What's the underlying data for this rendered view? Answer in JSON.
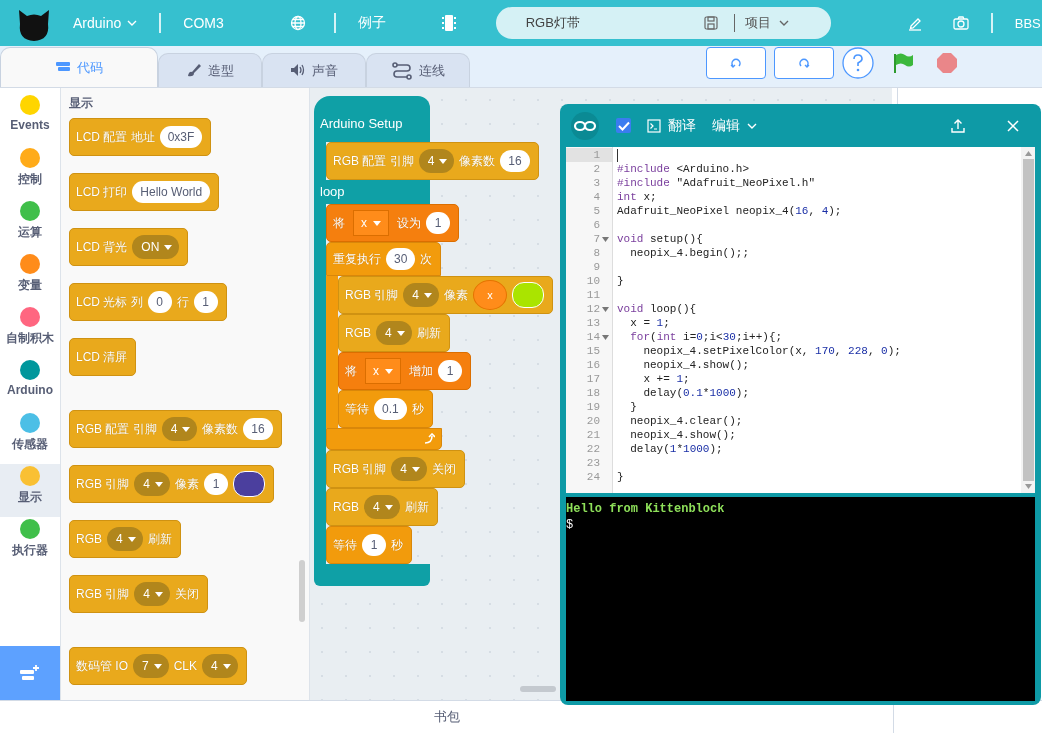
{
  "header": {
    "board": "Arduino",
    "port": "COM3",
    "examples": "例子",
    "project_name": "RGB灯带",
    "project_menu": "项目",
    "bbs": "BBS"
  },
  "tabs": [
    {
      "label": "代码",
      "selected": true
    },
    {
      "label": "造型",
      "selected": false
    },
    {
      "label": "声音",
      "selected": false
    },
    {
      "label": "连线",
      "selected": false
    }
  ],
  "categories": [
    {
      "label": "Events",
      "color": "#ffd500",
      "selected": false
    },
    {
      "label": "控制",
      "color": "#ffab19",
      "selected": false
    },
    {
      "label": "运算",
      "color": "#40bf4a",
      "selected": false
    },
    {
      "label": "变量",
      "color": "#ff8c1a",
      "selected": false
    },
    {
      "label": "自制积木",
      "color": "#ff6680",
      "selected": false
    },
    {
      "label": "Arduino",
      "color": "#00979c",
      "selected": false
    },
    {
      "label": "传感器",
      "color": "#4cbfe6",
      "selected": false
    },
    {
      "label": "显示",
      "color": "#f9c033",
      "selected": true
    },
    {
      "label": "执行器",
      "color": "#40bf4a",
      "selected": false
    }
  ],
  "palette": {
    "title": "显示",
    "groups": [
      [
        {
          "kind": "display",
          "parts": [
            {
              "kind": "label",
              "text": "LCD 配置 地址"
            },
            {
              "kind": "input",
              "text": "0x3F"
            }
          ]
        },
        {
          "kind": "display",
          "parts": [
            {
              "kind": "label",
              "text": "LCD 打印"
            },
            {
              "kind": "input",
              "text": "Hello World"
            }
          ]
        },
        {
          "kind": "display",
          "parts": [
            {
              "kind": "label",
              "text": "LCD 背光"
            },
            {
              "kind": "dropdown",
              "text": "ON"
            }
          ]
        },
        {
          "kind": "display",
          "parts": [
            {
              "kind": "label",
              "text": "LCD 光标 列"
            },
            {
              "kind": "input",
              "text": "0"
            },
            {
              "kind": "label",
              "text": "行"
            },
            {
              "kind": "input",
              "text": "1"
            }
          ]
        },
        {
          "kind": "display",
          "parts": [
            {
              "kind": "label",
              "text": "LCD 清屏"
            }
          ]
        }
      ],
      [
        {
          "kind": "display",
          "parts": [
            {
              "kind": "label",
              "text": "RGB 配置 引脚"
            },
            {
              "kind": "dropdown",
              "text": "4"
            },
            {
              "kind": "label",
              "text": "像素数"
            },
            {
              "kind": "input",
              "text": "16"
            }
          ]
        },
        {
          "kind": "display",
          "parts": [
            {
              "kind": "label",
              "text": "RGB 引脚"
            },
            {
              "kind": "dropdown",
              "text": "4"
            },
            {
              "kind": "label",
              "text": "像素"
            },
            {
              "kind": "input",
              "text": "1"
            },
            {
              "kind": "color",
              "color": "#4b3f9e"
            }
          ]
        },
        {
          "kind": "display",
          "parts": [
            {
              "kind": "label",
              "text": "RGB"
            },
            {
              "kind": "dropdown",
              "text": "4"
            },
            {
              "kind": "label",
              "text": "刷新"
            }
          ]
        },
        {
          "kind": "display",
          "parts": [
            {
              "kind": "label",
              "text": "RGB 引脚"
            },
            {
              "kind": "dropdown",
              "text": "4"
            },
            {
              "kind": "label",
              "text": "关闭"
            }
          ]
        }
      ],
      [
        {
          "kind": "display",
          "parts": [
            {
              "kind": "label",
              "text": "数码管 IO"
            },
            {
              "kind": "dropdown",
              "text": "7"
            },
            {
              "kind": "label",
              "text": "CLK"
            },
            {
              "kind": "dropdown",
              "text": "4"
            }
          ]
        }
      ]
    ]
  },
  "script": {
    "sections": [
      {
        "label": "Arduino Setup",
        "children": [
          {
            "kind": "display",
            "parts": [
              {
                "kind": "label",
                "text": "RGB 配置 引脚"
              },
              {
                "kind": "dropdown",
                "text": "4"
              },
              {
                "kind": "label",
                "text": "像素数"
              },
              {
                "kind": "input",
                "text": "16"
              }
            ]
          }
        ]
      },
      {
        "label": "loop",
        "children": [
          {
            "kind": "variable",
            "parts": [
              {
                "kind": "label",
                "text": "将"
              },
              {
                "kind": "variable",
                "text": "x"
              },
              {
                "kind": "label",
                "text": "设为"
              },
              {
                "kind": "input",
                "text": "1"
              }
            ]
          },
          {
            "kind": "control",
            "parts": [
              {
                "kind": "label",
                "text": "重复执行"
              },
              {
                "kind": "input",
                "text": "30"
              },
              {
                "kind": "label",
                "text": "次"
              }
            ],
            "children": [
              {
                "kind": "display",
                "parts": [
                  {
                    "kind": "label",
                    "text": "RGB 引脚"
                  },
                  {
                    "kind": "dropdown",
                    "text": "4"
                  },
                  {
                    "kind": "label",
                    "text": "像素"
                  },
                  {
                    "kind": "reporter",
                    "text": "x"
                  },
                  {
                    "kind": "color",
                    "color": "#aae400"
                  }
                ]
              },
              {
                "kind": "display",
                "parts": [
                  {
                    "kind": "label",
                    "text": "RGB"
                  },
                  {
                    "kind": "dropdown",
                    "text": "4"
                  },
                  {
                    "kind": "label",
                    "text": "刷新"
                  }
                ]
              },
              {
                "kind": "variable",
                "parts": [
                  {
                    "kind": "label",
                    "text": "将"
                  },
                  {
                    "kind": "variable",
                    "text": "x"
                  },
                  {
                    "kind": "label",
                    "text": "增加"
                  },
                  {
                    "kind": "input",
                    "text": "1"
                  }
                ]
              },
              {
                "kind": "control",
                "parts": [
                  {
                    "kind": "label",
                    "text": "等待"
                  },
                  {
                    "kind": "input",
                    "text": "0.1"
                  },
                  {
                    "kind": "label",
                    "text": "秒"
                  }
                ]
              }
            ]
          },
          {
            "kind": "display",
            "parts": [
              {
                "kind": "label",
                "text": "RGB 引脚"
              },
              {
                "kind": "dropdown",
                "text": "4"
              },
              {
                "kind": "label",
                "text": "关闭"
              }
            ]
          },
          {
            "kind": "display",
            "parts": [
              {
                "kind": "label",
                "text": "RGB"
              },
              {
                "kind": "dropdown",
                "text": "4"
              },
              {
                "kind": "label",
                "text": "刷新"
              }
            ]
          },
          {
            "kind": "control",
            "parts": [
              {
                "kind": "label",
                "text": "等待"
              },
              {
                "kind": "input",
                "text": "1"
              },
              {
                "kind": "label",
                "text": "秒"
              }
            ]
          }
        ]
      }
    ]
  },
  "code_window": {
    "checked": true,
    "translate": "翻译",
    "edit_menu": "编辑",
    "lines": [
      {
        "no": "1",
        "current": true,
        "fold": false
      },
      {
        "no": "2",
        "current": false,
        "fold": false,
        "segs": [
          {
            "t": "#include",
            "kind": "keyword"
          },
          {
            "t": " <Arduino.h>"
          }
        ]
      },
      {
        "no": "3",
        "current": false,
        "fold": false,
        "segs": [
          {
            "t": "#include",
            "kind": "keyword"
          },
          {
            "t": " \"Adafruit_NeoPixel.h\""
          }
        ]
      },
      {
        "no": "4",
        "current": false,
        "fold": false,
        "segs": [
          {
            "t": "int",
            "kind": "keyword"
          },
          {
            "t": " x;"
          }
        ]
      },
      {
        "no": "5",
        "current": false,
        "fold": false,
        "segs": [
          {
            "t": "Adafruit_NeoPixel neopix_4("
          },
          {
            "t": "16",
            "kind": "number"
          },
          {
            "t": ", "
          },
          {
            "t": "4",
            "kind": "number"
          },
          {
            "t": ");"
          }
        ]
      },
      {
        "no": "6",
        "current": false,
        "fold": false
      },
      {
        "no": "7",
        "current": false,
        "fold": true,
        "segs": [
          {
            "t": "void",
            "kind": "keyword"
          },
          {
            "t": " setup(){"
          }
        ]
      },
      {
        "no": "8",
        "current": false,
        "fold": false,
        "segs": [
          {
            "t": "  neopix_4.begin();;"
          }
        ]
      },
      {
        "no": "9",
        "current": false,
        "fold": false
      },
      {
        "no": "10",
        "current": false,
        "fold": false,
        "segs": [
          {
            "t": "}"
          }
        ]
      },
      {
        "no": "11",
        "current": false,
        "fold": false
      },
      {
        "no": "12",
        "current": false,
        "fold": true,
        "segs": [
          {
            "t": "void",
            "kind": "keyword"
          },
          {
            "t": " loop(){"
          }
        ]
      },
      {
        "no": "13",
        "current": false,
        "fold": false,
        "segs": [
          {
            "t": "  x = "
          },
          {
            "t": "1",
            "kind": "number"
          },
          {
            "t": ";"
          }
        ]
      },
      {
        "no": "14",
        "current": false,
        "fold": true,
        "segs": [
          {
            "t": "  for",
            "kind": "keyword"
          },
          {
            "t": "("
          },
          {
            "t": "int",
            "kind": "keyword"
          },
          {
            "t": " i="
          },
          {
            "t": "0",
            "kind": "number"
          },
          {
            "t": ";i<"
          },
          {
            "t": "30",
            "kind": "number"
          },
          {
            "t": ";i++){;"
          }
        ]
      },
      {
        "no": "15",
        "current": false,
        "fold": false,
        "segs": [
          {
            "t": "    neopix_4.setPixelColor(x, "
          },
          {
            "t": "170",
            "kind": "number"
          },
          {
            "t": ", "
          },
          {
            "t": "228",
            "kind": "number"
          },
          {
            "t": ", "
          },
          {
            "t": "0",
            "kind": "number"
          },
          {
            "t": ");"
          }
        ]
      },
      {
        "no": "16",
        "current": false,
        "fold": false,
        "segs": [
          {
            "t": "    neopix_4.show();"
          }
        ]
      },
      {
        "no": "17",
        "current": false,
        "fold": false,
        "segs": [
          {
            "t": "    x += "
          },
          {
            "t": "1",
            "kind": "number"
          },
          {
            "t": ";"
          }
        ]
      },
      {
        "no": "18",
        "current": false,
        "fold": false,
        "segs": [
          {
            "t": "    delay("
          },
          {
            "t": "0.1",
            "kind": "number"
          },
          {
            "t": "*"
          },
          {
            "t": "1000",
            "kind": "number"
          },
          {
            "t": ");"
          }
        ]
      },
      {
        "no": "19",
        "current": false,
        "fold": false,
        "segs": [
          {
            "t": "  }"
          }
        ]
      },
      {
        "no": "20",
        "current": false,
        "fold": false,
        "segs": [
          {
            "t": "  neopix_4.clear();"
          }
        ]
      },
      {
        "no": "21",
        "current": false,
        "fold": false,
        "segs": [
          {
            "t": "  neopix_4.show();"
          }
        ]
      },
      {
        "no": "22",
        "current": false,
        "fold": false,
        "segs": [
          {
            "t": "  delay("
          },
          {
            "t": "1",
            "kind": "number"
          },
          {
            "t": "*"
          },
          {
            "t": "1000",
            "kind": "number"
          },
          {
            "t": ");"
          }
        ]
      },
      {
        "no": "23",
        "current": false,
        "fold": false
      },
      {
        "no": "24",
        "current": false,
        "fold": false,
        "segs": [
          {
            "t": "}"
          }
        ]
      }
    ],
    "terminal": [
      "Hello from Kittenblock",
      "$"
    ]
  },
  "backpack": "书包"
}
